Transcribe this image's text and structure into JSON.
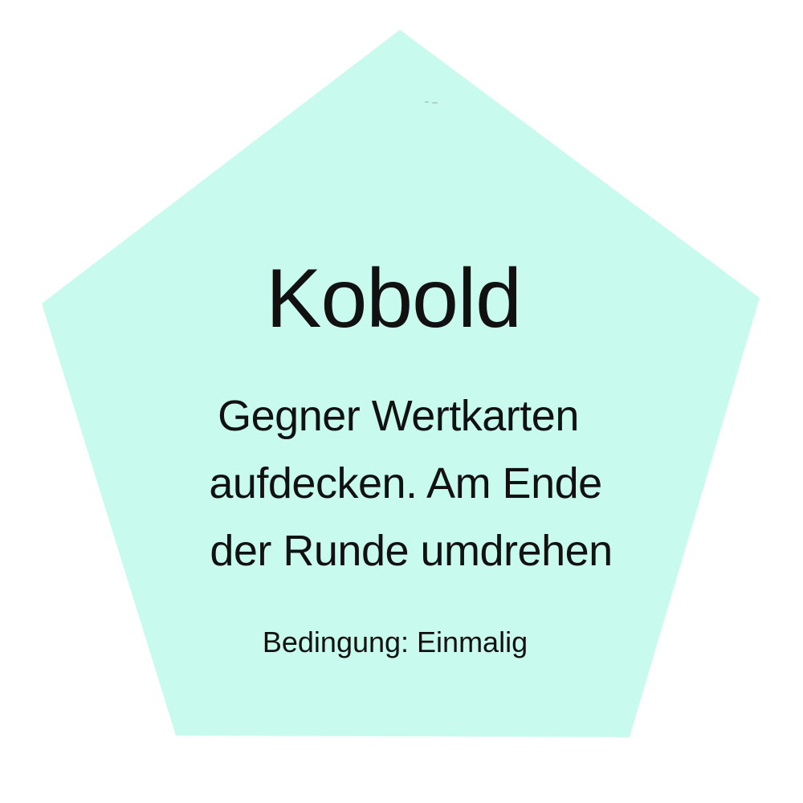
{
  "card": {
    "title": "Kobold",
    "description_lines": [
      "Gegner Wertkarten",
      "aufdecken. Am Ende",
      "der Runde umdrehen"
    ],
    "condition": "Bedingung: Einmalig"
  },
  "colors": {
    "card_fill": "#c8fbed",
    "text": "#111111",
    "background": "#ffffff"
  }
}
